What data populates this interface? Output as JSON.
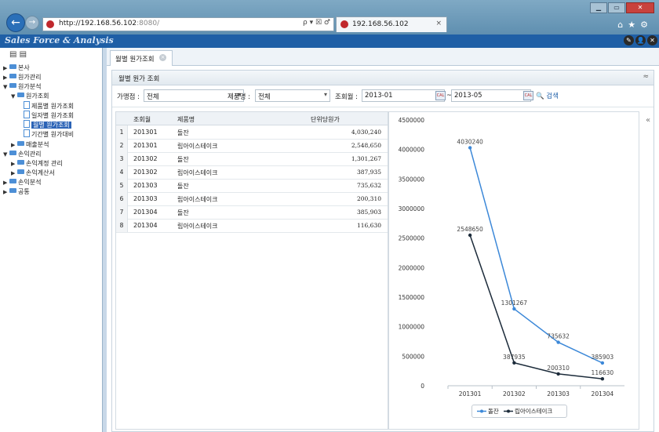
{
  "browser": {
    "url_host": "http://192.168.56.102",
    "url_port": ":8080/",
    "url_controls": "ρ ▾ ☒ ♂",
    "tab_title": "192.168.56.102",
    "tab_close": "×",
    "window_minimize": "▁",
    "window_maximize": "▭",
    "window_close": "✕",
    "toolbar_icons": "⌂★⚙"
  },
  "app": {
    "title": "Sales Force & Analysis",
    "header_icons": [
      "✎",
      "👤",
      "✕"
    ]
  },
  "sidebar": {
    "top_icons": "▤ ▤",
    "tree": [
      {
        "label": "본사",
        "arrow": "▶",
        "type": "folder"
      },
      {
        "label": "원가관리",
        "arrow": "▶",
        "type": "folder"
      },
      {
        "label": "원가분석",
        "arrow": "▼",
        "type": "folder"
      },
      {
        "label": "원가조회",
        "arrow": "▼",
        "type": "folder"
      },
      {
        "label": "제품별 원가조회",
        "arrow": "",
        "type": "page"
      },
      {
        "label": "일자별 원가조회",
        "arrow": "",
        "type": "page"
      },
      {
        "label": "월별 원가조회",
        "arrow": "",
        "type": "page"
      },
      {
        "label": "기간별 원가대비",
        "arrow": "",
        "type": "page"
      },
      {
        "label": "매출분석",
        "arrow": "▶",
        "type": "folder"
      },
      {
        "label": "손익관리",
        "arrow": "▼",
        "type": "folder"
      },
      {
        "label": "손익계정 관리",
        "arrow": "▶",
        "type": "folder"
      },
      {
        "label": "손익계산서",
        "arrow": "▶",
        "type": "folder"
      },
      {
        "label": "손익분석",
        "arrow": "▶",
        "type": "folder"
      },
      {
        "label": "공통",
        "arrow": "▶",
        "type": "folder"
      }
    ]
  },
  "content_tab": {
    "label": "월별 원가조회",
    "close": "×"
  },
  "panel": {
    "title": "월별 원가 조회",
    "collapse": "≈"
  },
  "filters": {
    "store_label": "가맹점 :",
    "store_value": "전체",
    "product_label": "제품명 :",
    "product_value": "전체",
    "date_label": "조회월 :",
    "date_from": "2013-01",
    "separator": "~",
    "date_to": "2013-05",
    "search_label": "검색",
    "calendar_text": "CAL"
  },
  "grid": {
    "columns": [
      "조회월",
      "제품명",
      "단위당원가"
    ],
    "rows": [
      {
        "num": "1",
        "month": "201301",
        "product": "돌잔",
        "cost": "4,030,240"
      },
      {
        "num": "2",
        "month": "201301",
        "product": "립아이스테이크",
        "cost": "2,548,650"
      },
      {
        "num": "3",
        "month": "201302",
        "product": "돌잔",
        "cost": "1,301,267"
      },
      {
        "num": "4",
        "month": "201302",
        "product": "립아이스테이크",
        "cost": "387,935"
      },
      {
        "num": "5",
        "month": "201303",
        "product": "돌잔",
        "cost": "735,632"
      },
      {
        "num": "6",
        "month": "201303",
        "product": "립아이스테이크",
        "cost": "200,310"
      },
      {
        "num": "7",
        "month": "201304",
        "product": "돌잔",
        "cost": "385,903"
      },
      {
        "num": "8",
        "month": "201304",
        "product": "립아이스테이크",
        "cost": "116,630"
      }
    ]
  },
  "chart_collapse": "«",
  "chart_data": {
    "type": "line",
    "categories": [
      "201301",
      "201302",
      "201303",
      "201304"
    ],
    "series": [
      {
        "name": "돌잔",
        "values": [
          4030240,
          1301267,
          735632,
          385903
        ],
        "color": "#3c88d8"
      },
      {
        "name": "립아이스테이크",
        "values": [
          2548650,
          387935,
          200310,
          116630
        ],
        "color": "#1c2b3a"
      }
    ],
    "ylim": [
      0,
      4500000
    ],
    "yticks": [
      0,
      500000,
      1000000,
      1500000,
      2000000,
      2500000,
      3000000,
      3500000,
      4000000,
      4500000
    ],
    "grid": false,
    "legend_position": "bottom-center",
    "data_labels": true
  }
}
